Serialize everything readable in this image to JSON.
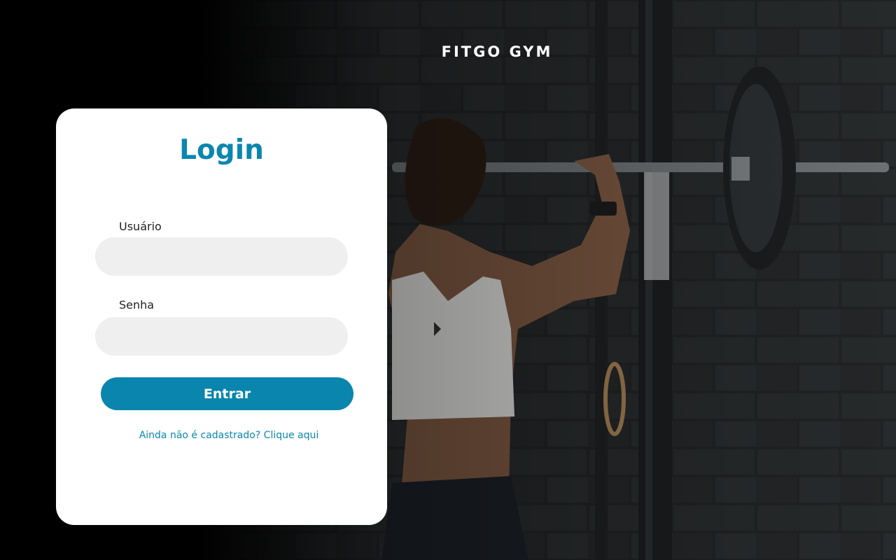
{
  "brand": {
    "name": "FITGO GYM"
  },
  "login": {
    "title": "Login",
    "username_label": "Usuário",
    "username_value": "",
    "password_label": "Senha",
    "password_value": "",
    "submit_label": "Entrar",
    "signup_link": "Ainda não é cadastrado? Clique aqui"
  },
  "colors": {
    "accent": "#0a86b0",
    "button": "#0a85ae",
    "input_bg": "#efefef",
    "card_bg": "#ffffff"
  }
}
